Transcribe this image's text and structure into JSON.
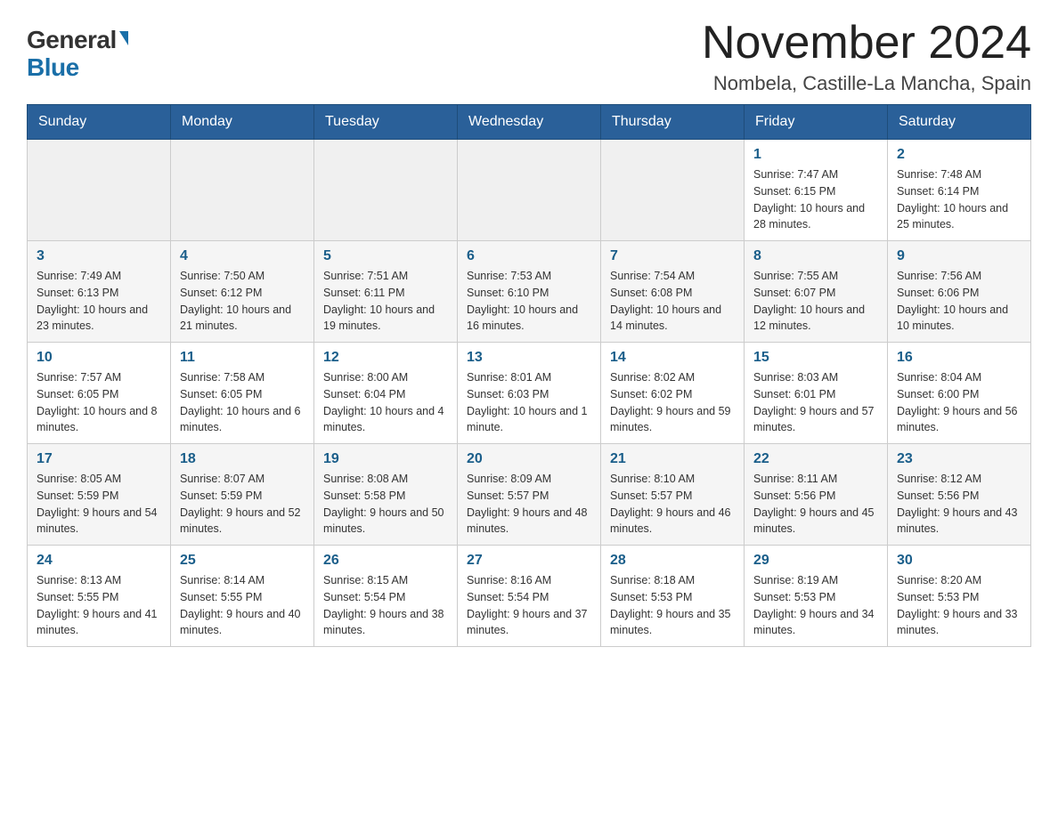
{
  "logo": {
    "general": "General",
    "blue": "Blue",
    "triangle": "▶"
  },
  "title": {
    "month_year": "November 2024",
    "location": "Nombela, Castille-La Mancha, Spain"
  },
  "weekdays": [
    "Sunday",
    "Monday",
    "Tuesday",
    "Wednesday",
    "Thursday",
    "Friday",
    "Saturday"
  ],
  "weeks": [
    [
      {
        "day": "",
        "info": ""
      },
      {
        "day": "",
        "info": ""
      },
      {
        "day": "",
        "info": ""
      },
      {
        "day": "",
        "info": ""
      },
      {
        "day": "",
        "info": ""
      },
      {
        "day": "1",
        "info": "Sunrise: 7:47 AM\nSunset: 6:15 PM\nDaylight: 10 hours and 28 minutes."
      },
      {
        "day": "2",
        "info": "Sunrise: 7:48 AM\nSunset: 6:14 PM\nDaylight: 10 hours and 25 minutes."
      }
    ],
    [
      {
        "day": "3",
        "info": "Sunrise: 7:49 AM\nSunset: 6:13 PM\nDaylight: 10 hours and 23 minutes."
      },
      {
        "day": "4",
        "info": "Sunrise: 7:50 AM\nSunset: 6:12 PM\nDaylight: 10 hours and 21 minutes."
      },
      {
        "day": "5",
        "info": "Sunrise: 7:51 AM\nSunset: 6:11 PM\nDaylight: 10 hours and 19 minutes."
      },
      {
        "day": "6",
        "info": "Sunrise: 7:53 AM\nSunset: 6:10 PM\nDaylight: 10 hours and 16 minutes."
      },
      {
        "day": "7",
        "info": "Sunrise: 7:54 AM\nSunset: 6:08 PM\nDaylight: 10 hours and 14 minutes."
      },
      {
        "day": "8",
        "info": "Sunrise: 7:55 AM\nSunset: 6:07 PM\nDaylight: 10 hours and 12 minutes."
      },
      {
        "day": "9",
        "info": "Sunrise: 7:56 AM\nSunset: 6:06 PM\nDaylight: 10 hours and 10 minutes."
      }
    ],
    [
      {
        "day": "10",
        "info": "Sunrise: 7:57 AM\nSunset: 6:05 PM\nDaylight: 10 hours and 8 minutes."
      },
      {
        "day": "11",
        "info": "Sunrise: 7:58 AM\nSunset: 6:05 PM\nDaylight: 10 hours and 6 minutes."
      },
      {
        "day": "12",
        "info": "Sunrise: 8:00 AM\nSunset: 6:04 PM\nDaylight: 10 hours and 4 minutes."
      },
      {
        "day": "13",
        "info": "Sunrise: 8:01 AM\nSunset: 6:03 PM\nDaylight: 10 hours and 1 minute."
      },
      {
        "day": "14",
        "info": "Sunrise: 8:02 AM\nSunset: 6:02 PM\nDaylight: 9 hours and 59 minutes."
      },
      {
        "day": "15",
        "info": "Sunrise: 8:03 AM\nSunset: 6:01 PM\nDaylight: 9 hours and 57 minutes."
      },
      {
        "day": "16",
        "info": "Sunrise: 8:04 AM\nSunset: 6:00 PM\nDaylight: 9 hours and 56 minutes."
      }
    ],
    [
      {
        "day": "17",
        "info": "Sunrise: 8:05 AM\nSunset: 5:59 PM\nDaylight: 9 hours and 54 minutes."
      },
      {
        "day": "18",
        "info": "Sunrise: 8:07 AM\nSunset: 5:59 PM\nDaylight: 9 hours and 52 minutes."
      },
      {
        "day": "19",
        "info": "Sunrise: 8:08 AM\nSunset: 5:58 PM\nDaylight: 9 hours and 50 minutes."
      },
      {
        "day": "20",
        "info": "Sunrise: 8:09 AM\nSunset: 5:57 PM\nDaylight: 9 hours and 48 minutes."
      },
      {
        "day": "21",
        "info": "Sunrise: 8:10 AM\nSunset: 5:57 PM\nDaylight: 9 hours and 46 minutes."
      },
      {
        "day": "22",
        "info": "Sunrise: 8:11 AM\nSunset: 5:56 PM\nDaylight: 9 hours and 45 minutes."
      },
      {
        "day": "23",
        "info": "Sunrise: 8:12 AM\nSunset: 5:56 PM\nDaylight: 9 hours and 43 minutes."
      }
    ],
    [
      {
        "day": "24",
        "info": "Sunrise: 8:13 AM\nSunset: 5:55 PM\nDaylight: 9 hours and 41 minutes."
      },
      {
        "day": "25",
        "info": "Sunrise: 8:14 AM\nSunset: 5:55 PM\nDaylight: 9 hours and 40 minutes."
      },
      {
        "day": "26",
        "info": "Sunrise: 8:15 AM\nSunset: 5:54 PM\nDaylight: 9 hours and 38 minutes."
      },
      {
        "day": "27",
        "info": "Sunrise: 8:16 AM\nSunset: 5:54 PM\nDaylight: 9 hours and 37 minutes."
      },
      {
        "day": "28",
        "info": "Sunrise: 8:18 AM\nSunset: 5:53 PM\nDaylight: 9 hours and 35 minutes."
      },
      {
        "day": "29",
        "info": "Sunrise: 8:19 AM\nSunset: 5:53 PM\nDaylight: 9 hours and 34 minutes."
      },
      {
        "day": "30",
        "info": "Sunrise: 8:20 AM\nSunset: 5:53 PM\nDaylight: 9 hours and 33 minutes."
      }
    ]
  ]
}
